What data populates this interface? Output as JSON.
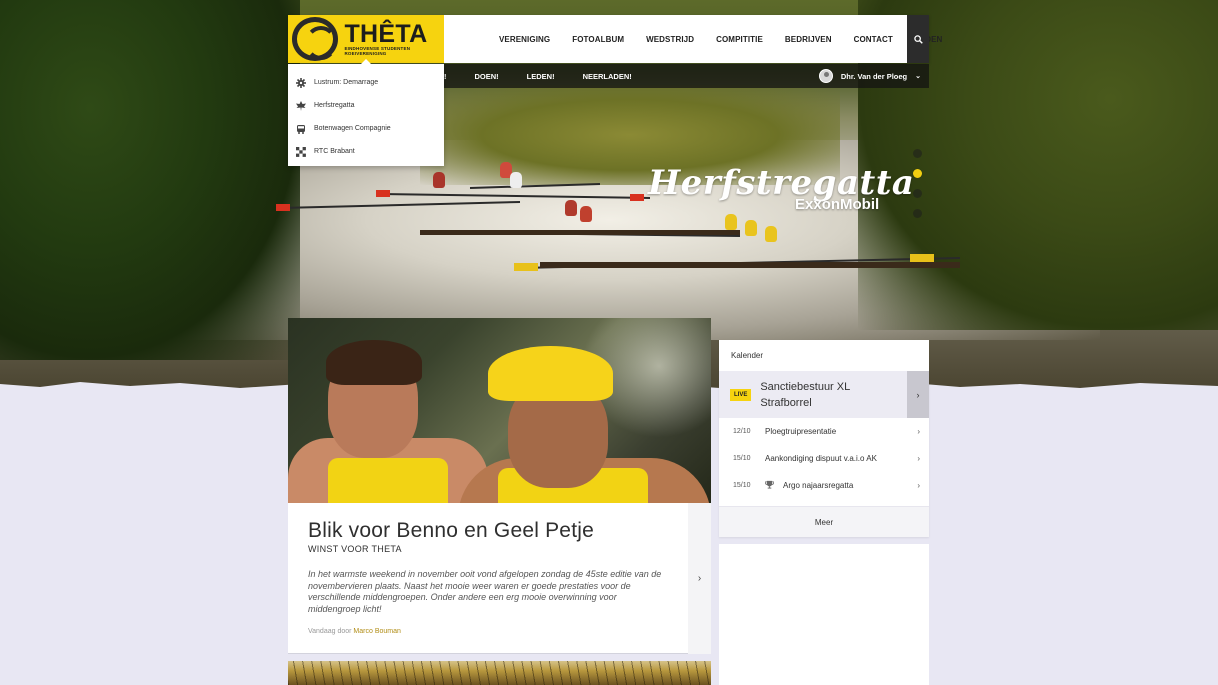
{
  "brand": {
    "name": "THÊTA",
    "tagline": "EINDHOVENSE STUDENTEN ROEIVERENIGING",
    "accent": "#f6d30f"
  },
  "nav": {
    "items": [
      "VERENIGING",
      "FOTOALBUM",
      "WEDSTRIJD",
      "COMPITITIE",
      "BEDRIJVEN",
      "CONTACT",
      "LEDEN"
    ],
    "search_icon": "search-icon"
  },
  "subnav": {
    "items": [
      "!",
      "DOEN!",
      "LEDEN!",
      "NEERLADEN!"
    ],
    "user_name": "Dhr. Van der Ploeg"
  },
  "dropdown": {
    "items": [
      {
        "label": "Lustrum: Demarrage",
        "icon": "gear-icon"
      },
      {
        "label": "Herfstregatta",
        "icon": "leaf-icon"
      },
      {
        "label": "Botenwagen Compagnie",
        "icon": "bus-icon"
      },
      {
        "label": "RTC Brabant",
        "icon": "checkered-flag-icon"
      }
    ]
  },
  "hero": {
    "title": "Herfstregatta",
    "sponsor": "ExxonMobil",
    "active_slide": 2
  },
  "article": {
    "title": "Blik voor Benno en Geel Petje",
    "subtitle": "WINST VOOR THETA",
    "excerpt": "In het warmste weekend in november ooit vond afgelopen zondag de 45ste editie van de novembervieren plaats. Naast het mooie weer waren er goede prestaties voor de verschillende middengroepen. Onder andere een erg mooie overwinning voor middengroep licht!",
    "meta_prefix": "Vandaag door",
    "author": "Marco Bouman"
  },
  "calendar": {
    "title": "Kalender",
    "live_badge": "LIVE",
    "live_event": "Sanctiebestuur XL Strafborrel",
    "events": [
      {
        "date": "12/10",
        "title": "Ploegtruipresentatie",
        "icon": ""
      },
      {
        "date": "15/10",
        "title": "Aankondiging dispuut v.a.i.o AK",
        "icon": ""
      },
      {
        "date": "15/10",
        "title": "Argo najaarsregatta",
        "icon": "trophy-icon"
      }
    ],
    "more_label": "Meer"
  }
}
